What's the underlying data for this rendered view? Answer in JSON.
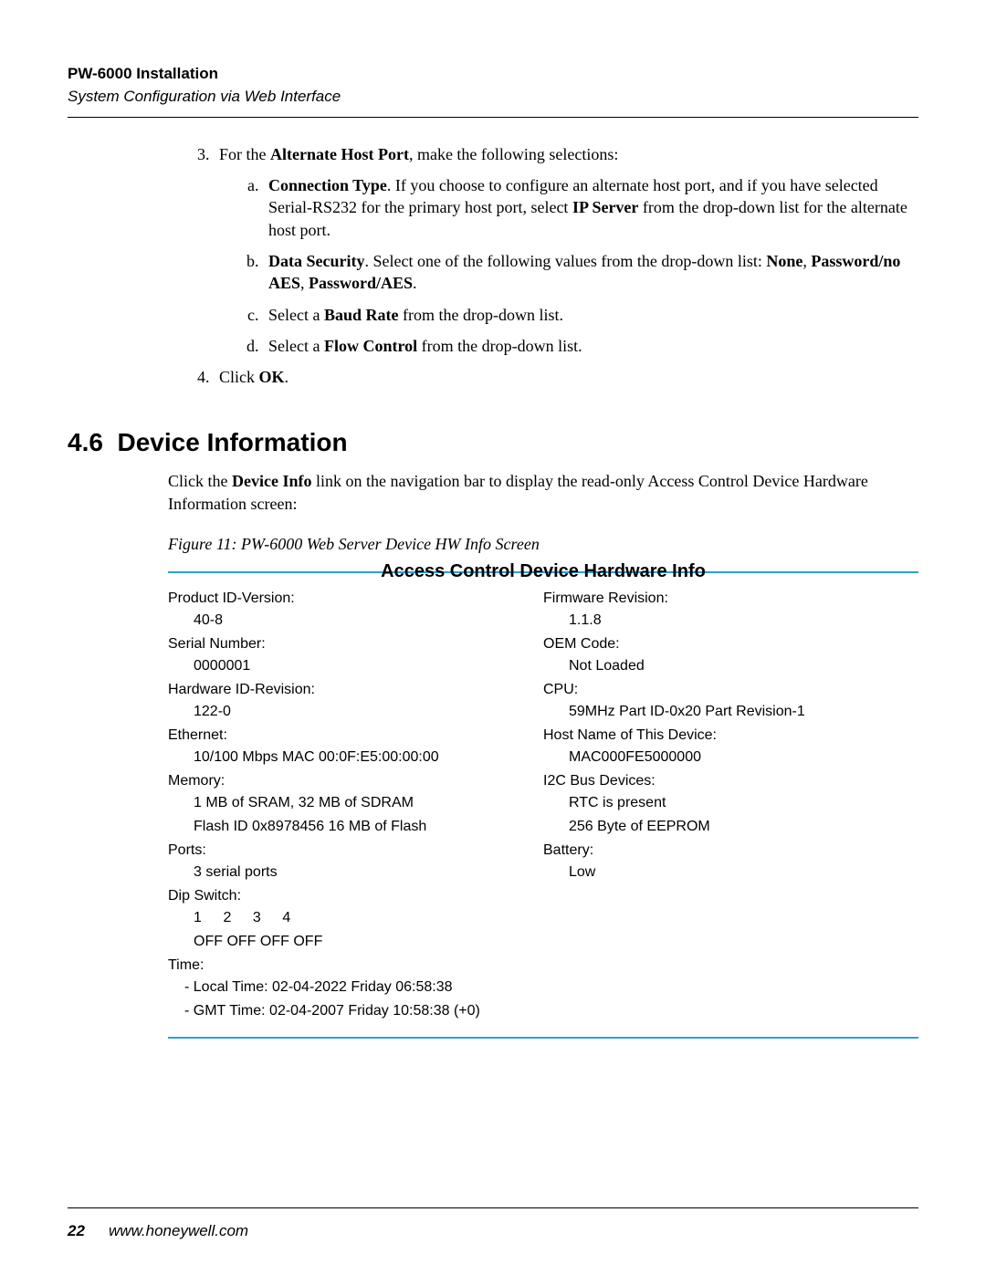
{
  "header": {
    "title": "PW-6000 Installation",
    "subtitle": "System Configuration via Web Interface"
  },
  "step3": {
    "lead_pre": "For the ",
    "lead_bold": "Alternate Host Port",
    "lead_post": ", make the following selections:",
    "a": {
      "bold1": "Connection Type",
      "text1": ". If you choose to configure an alternate host port, and if you have selected Serial-RS232 for the primary host port, select ",
      "bold2": "IP Server",
      "text2": " from the drop-down list for the alternate host port."
    },
    "b": {
      "bold1": "Data Security",
      "text1": ". Select one of the following values from the drop-down list: ",
      "bold2": "None",
      "sep1": ", ",
      "bold3": "Password/no AES",
      "sep2": ", ",
      "bold4": "Password/AES",
      "end": "."
    },
    "c": {
      "pre": "Select a ",
      "bold": "Baud Rate",
      "post": " from the drop-down list."
    },
    "d": {
      "pre": "Select a ",
      "bold": "Flow Control",
      "post": " from the drop-down list."
    }
  },
  "step4": {
    "pre": "Click ",
    "bold": "OK",
    "post": "."
  },
  "section": {
    "num": "4.6",
    "title": "Device Information"
  },
  "desc": {
    "pre": "Click the ",
    "bold": "Device Info",
    "post": " link on the navigation bar to display the read-only Access Control Device Hardware Information screen:"
  },
  "figure_caption": "Figure 11:    PW-6000 Web Server Device HW Info Screen",
  "panel_title": "Access Control Device Hardware Info",
  "left": {
    "product_label": "Product ID-Version:",
    "product_value": "40-8",
    "serial_label": "Serial Number:",
    "serial_value": "0000001",
    "hw_label": "Hardware ID-Revision:",
    "hw_value": "122-0",
    "eth_label": "Ethernet:",
    "eth_value": "10/100 Mbps MAC 00:0F:E5:00:00:00",
    "mem_label": "Memory:",
    "mem_value1": "1 MB of SRAM, 32 MB of SDRAM",
    "mem_value2": "Flash ID 0x8978456  16 MB of Flash",
    "ports_label": "Ports:",
    "ports_value": "3 serial ports",
    "dip_label": "Dip Switch:",
    "dip1": "1",
    "dip2": "2",
    "dip3": "3",
    "dip4": "4",
    "dipA": "OFF",
    "dipB": "OFF",
    "dipC": "OFF",
    "dipD": "OFF",
    "time_label": "Time:",
    "time_local": "- Local Time: 02-04-2022 Friday  06:58:38",
    "time_gmt": "- GMT Time: 02-04-2007 Friday 10:58:38 (+0)"
  },
  "right": {
    "fw_label": "Firmware Revision:",
    "fw_value": "1.1.8",
    "oem_label": "OEM Code:",
    "oem_value": "Not Loaded",
    "cpu_label": "CPU:",
    "cpu_value": "59MHz Part ID-0x20 Part Revision-1",
    "host_label": "Host Name of This Device:",
    "host_value": "MAC000FE5000000",
    "i2c_label": "I2C Bus Devices:",
    "i2c_value1": "RTC is present",
    "i2c_value2": "256 Byte of EEPROM",
    "bat_label": "Battery:",
    "bat_value": "Low"
  },
  "footer": {
    "page_number": "22",
    "site": "www.honeywell.com"
  }
}
